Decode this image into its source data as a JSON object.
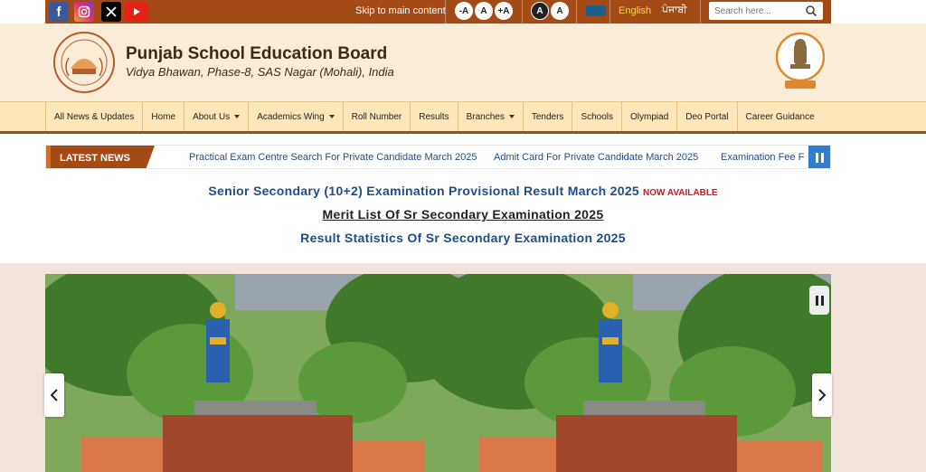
{
  "topbar": {
    "social": [
      "facebook-icon",
      "instagram-icon",
      "x-icon",
      "youtube-icon"
    ],
    "skip_link": "Skip to main content",
    "font_controls": [
      "-A",
      "A",
      "+A"
    ],
    "contrast_controls": [
      "A",
      "A"
    ],
    "lang_english": "English",
    "lang_punjabi": "ਪੰਜਾਬੀ",
    "search_placeholder": "Search here...",
    "colors": {
      "bar": "#a34a16",
      "lang_active": "#ffd84a"
    }
  },
  "header": {
    "title": "Punjab School Education Board",
    "subtitle": "Vidya Bhawan, Phase-8, SAS Nagar (Mohali), India"
  },
  "nav": {
    "items": [
      {
        "label": "All News & Updates",
        "dropdown": false
      },
      {
        "label": "Home",
        "dropdown": false
      },
      {
        "label": "About Us",
        "dropdown": true
      },
      {
        "label": "Academics Wing",
        "dropdown": true
      },
      {
        "label": "Roll Number",
        "dropdown": false
      },
      {
        "label": "Results",
        "dropdown": false
      },
      {
        "label": "Branches",
        "dropdown": true
      },
      {
        "label": "Tenders",
        "dropdown": false
      },
      {
        "label": "Schools",
        "dropdown": false
      },
      {
        "label": "Olympiad",
        "dropdown": false
      },
      {
        "label": "Deo Portal",
        "dropdown": false
      },
      {
        "label": "Career Guidance",
        "dropdown": false
      }
    ]
  },
  "ticker": {
    "label": "LATEST NEWS",
    "items": [
      "Practical Exam Centre Search For Private Candidate March 2025",
      "Admit Card For Private Candidate March 2025",
      "Examination Fee F"
    ]
  },
  "headlines": {
    "h1": "Senior Secondary (10+2) Examination Provisional Result March 2025",
    "h1_badge": "NOW AVAILABLE",
    "h2": "Merit List Of Sr Secondary Examination 2025",
    "h3": "Result Statistics Of Sr Secondary Examination 2025"
  },
  "banner": {
    "prev": "‹",
    "next": "›"
  }
}
